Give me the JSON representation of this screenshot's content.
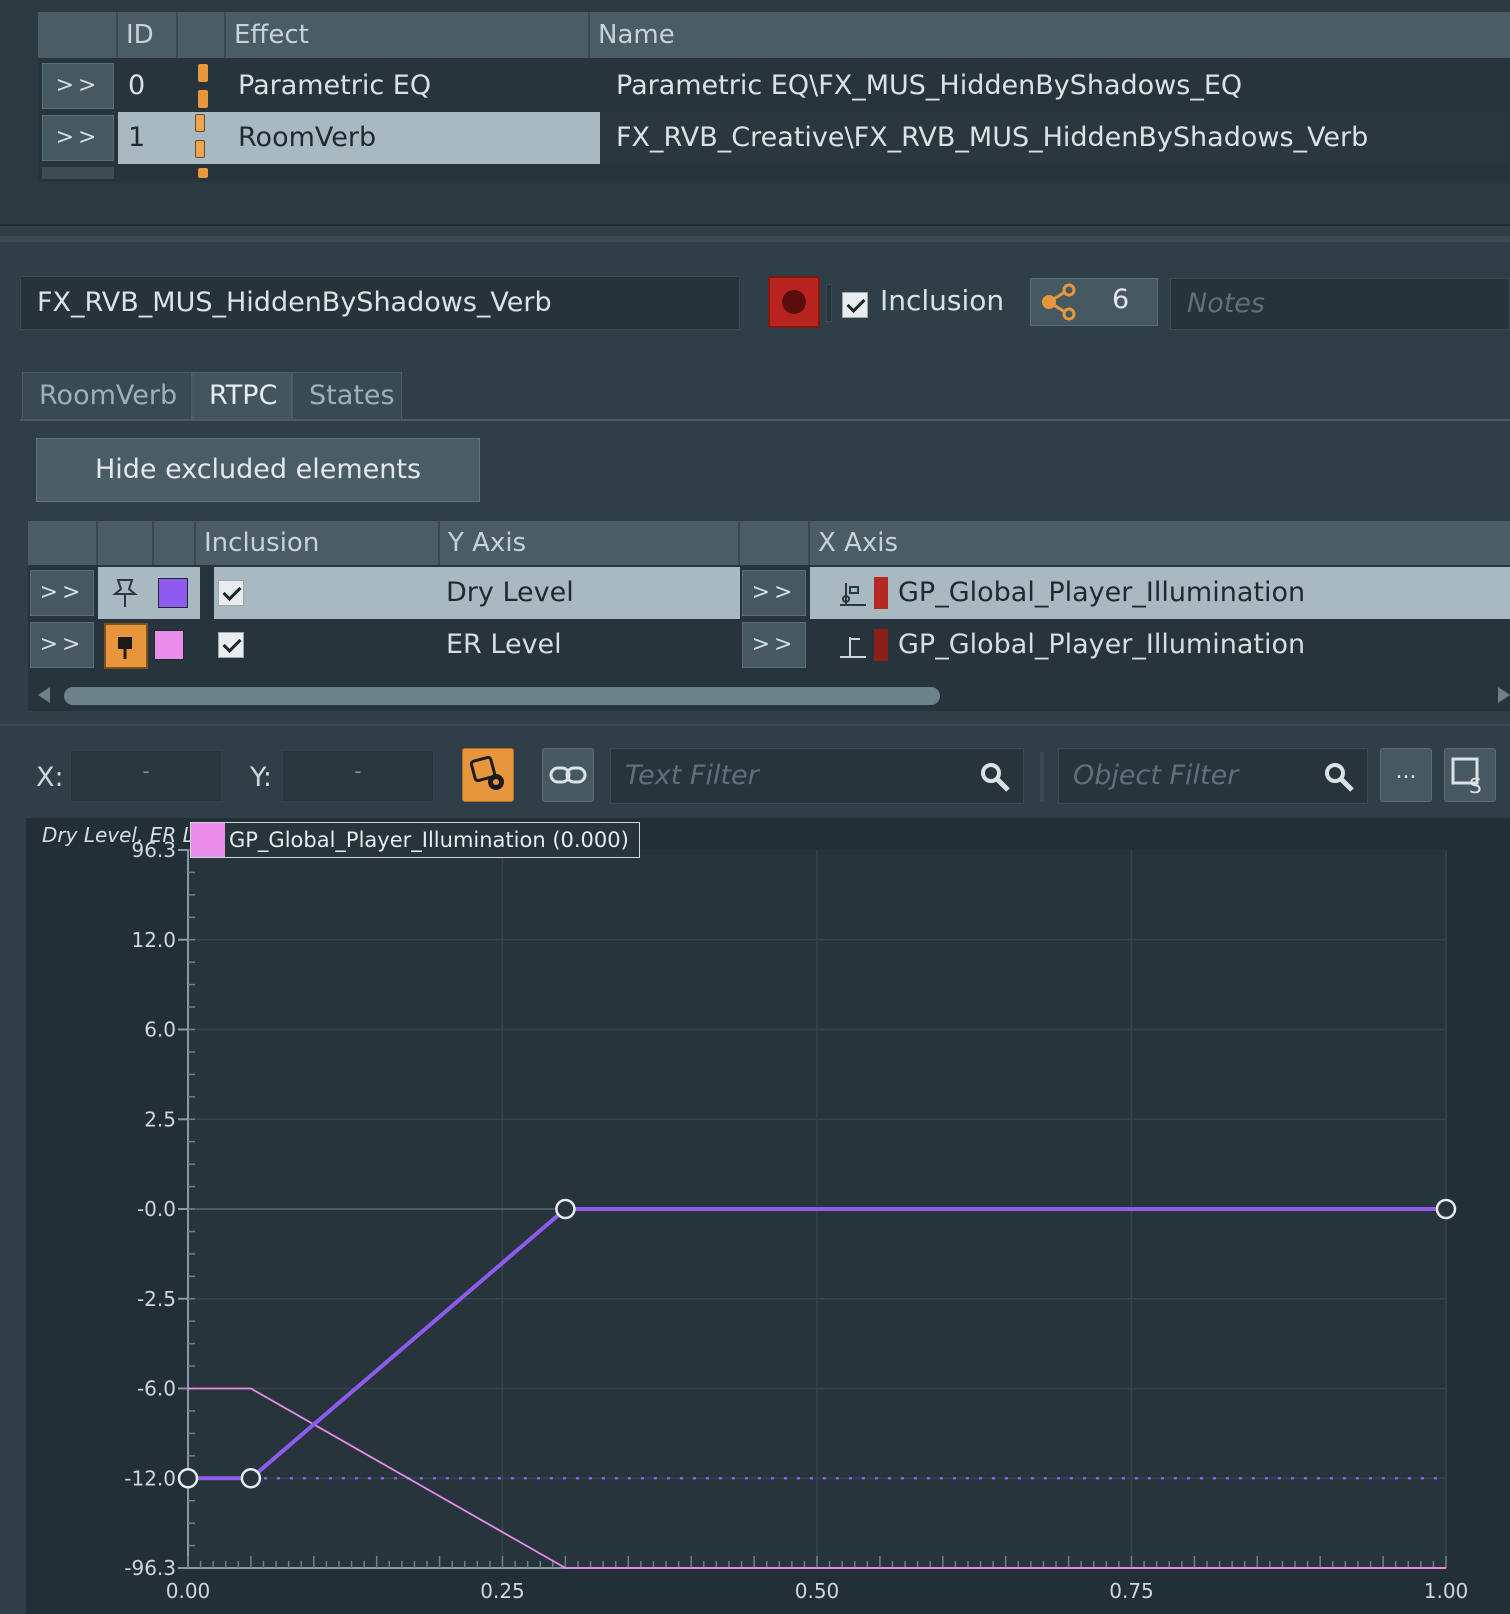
{
  "effects_table": {
    "headers": {
      "id": "ID",
      "effect": "Effect",
      "name": "Name"
    },
    "rows": [
      {
        "expand": ">>",
        "id": "0",
        "effect": "Parametric EQ",
        "name": "Parametric EQ\\FX_MUS_HiddenByShadows_EQ",
        "selected": false
      },
      {
        "expand": ">>",
        "id": "1",
        "effect": "RoomVerb",
        "name": "FX_RVB_Creative\\FX_RVB_MUS_HiddenByShadows_Verb",
        "selected": true
      }
    ]
  },
  "object_header": {
    "name": "FX_RVB_MUS_HiddenByShadows_Verb",
    "color_accent": "#b8241d",
    "inclusion_label": "Inclusion",
    "inclusion_checked": true,
    "references_icon": "share-graph-icon",
    "references_count": "6",
    "notes_placeholder": "Notes"
  },
  "tabs": [
    {
      "label": "RoomVerb",
      "active": false
    },
    {
      "label": "RTPC",
      "active": true
    },
    {
      "label": "States",
      "active": false
    }
  ],
  "hide_excluded_label": "Hide excluded elements",
  "rtpc_table": {
    "headers": {
      "inclusion": "Inclusion",
      "y_axis": "Y Axis",
      "x_axis": "X Axis"
    },
    "rows": [
      {
        "expand": ">>",
        "pin_icon": "pin-icon",
        "color": "#8f5af0",
        "included": true,
        "y_axis": "Dry Level",
        "x_expand": ">>",
        "x_axis": "GP_Global_Player_Illumination",
        "selected": true
      },
      {
        "expand": ">>",
        "pin_icon": "pin-icon",
        "color": "#e98cea",
        "included": true,
        "y_axis": "ER Level",
        "x_expand": ">>",
        "x_axis": "GP_Global_Player_Illumination",
        "selected": false
      }
    ]
  },
  "graph_toolbar": {
    "x_label": "X:",
    "x_value": "-",
    "y_label": "Y:",
    "y_value": "-",
    "text_filter_placeholder": "Text Filter",
    "object_filter_placeholder": "Object Filter",
    "more_label": "..."
  },
  "chart_data": {
    "type": "line",
    "ylabel": "Dry Level, ER Le",
    "legend": "GP_Global_Player_Illumination (0.000)",
    "x_ticks": [
      "0.00",
      "0.25",
      "0.50",
      "0.75",
      "1.00"
    ],
    "y_ticks": [
      "96.3",
      "12.0",
      "6.0",
      "2.5",
      "-0.0",
      "-2.5",
      "-6.0",
      "-12.0",
      "-96.3"
    ],
    "xlim": [
      0,
      1
    ],
    "grid": true,
    "series": [
      {
        "color": "#8f5af0",
        "x": [
          0.0,
          0.05,
          0.3,
          1.0
        ],
        "y": [
          -12.0,
          -12.0,
          0.0,
          0.0
        ]
      },
      {
        "color": "#e98cea",
        "x": [
          0.0,
          0.05,
          0.3,
          1.0
        ],
        "y": [
          -6.0,
          -6.0,
          -96.3,
          -96.3
        ]
      }
    ]
  }
}
